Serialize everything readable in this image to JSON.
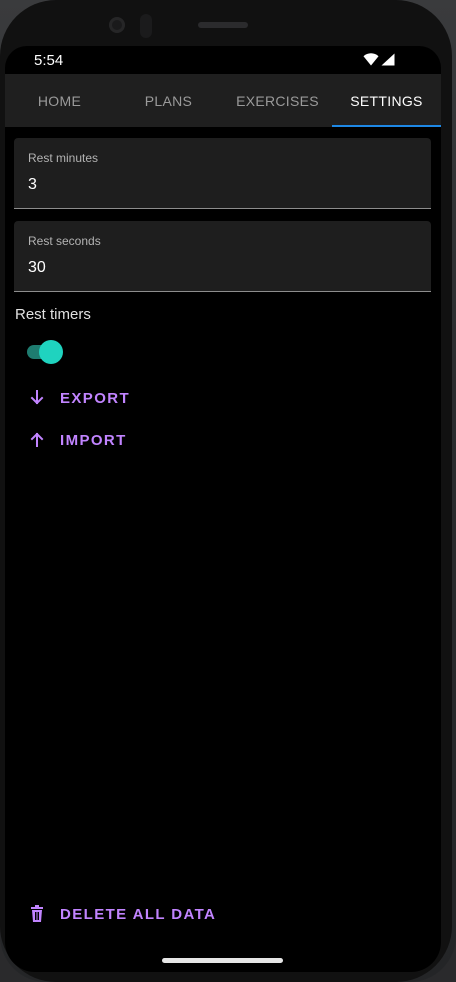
{
  "status_bar": {
    "time": "5:54",
    "icons": [
      "wifi-icon",
      "cell-signal-icon"
    ]
  },
  "tabs": [
    {
      "label": "HOME",
      "active": false
    },
    {
      "label": "PLANS",
      "active": false
    },
    {
      "label": "EXERCISES",
      "active": false
    },
    {
      "label": "SETTINGS",
      "active": true
    }
  ],
  "settings": {
    "rest_minutes": {
      "label": "Rest minutes",
      "value": "3"
    },
    "rest_seconds": {
      "label": "Rest seconds",
      "value": "30"
    },
    "rest_timers": {
      "label": "Rest timers",
      "enabled": true
    },
    "export_label": "EXPORT",
    "import_label": "IMPORT",
    "delete_label": "DELETE ALL DATA"
  },
  "colors": {
    "accent_purple": "#c184ff",
    "tab_indicator": "#1e88e5",
    "switch_thumb": "#1fd3bf",
    "switch_track": "#1e7c70",
    "background": "#000000",
    "tab_bar": "#1f1f1f",
    "field_background": "#1e1e1e"
  }
}
